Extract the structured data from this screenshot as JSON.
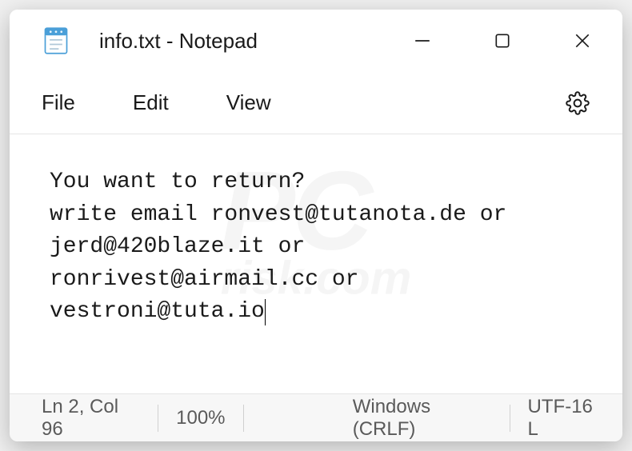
{
  "window": {
    "title": "info.txt - Notepad"
  },
  "menu": {
    "file": "File",
    "edit": "Edit",
    "view": "View"
  },
  "content": {
    "text": "You want to return?\nwrite email ronvest@tutanota.de or jerd@420blaze.it or ronrivest@airmail.cc or vestroni@tuta.io"
  },
  "statusbar": {
    "position": "Ln 2, Col 96",
    "zoom": "100%",
    "line_ending": "Windows (CRLF)",
    "encoding": "UTF-16 L"
  },
  "watermark": {
    "main": "PC",
    "sub": "risk.com"
  }
}
